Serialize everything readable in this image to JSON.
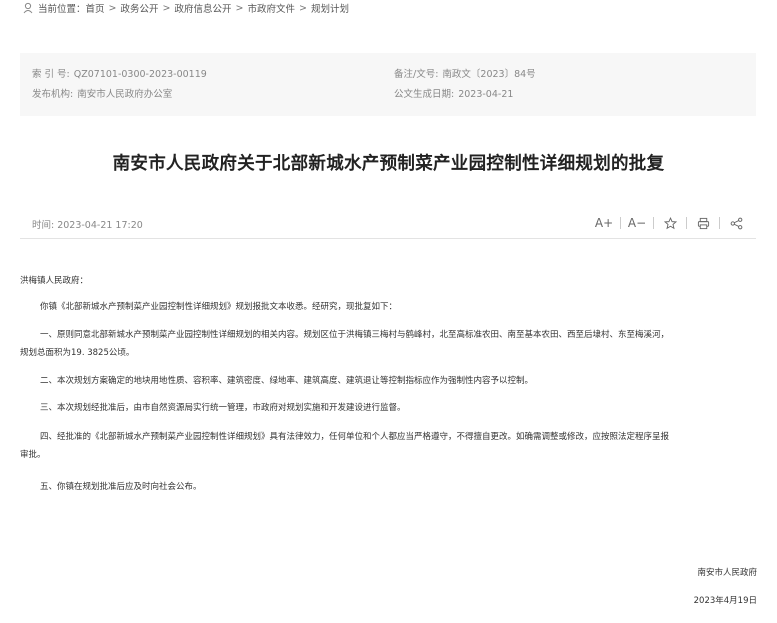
{
  "breadcrumb": {
    "prefix": "当前位置：",
    "items": [
      "首页",
      "政务公开",
      "政府信息公开",
      "市政府文件",
      "规划计划"
    ]
  },
  "meta": {
    "index_label": "索 引 号:",
    "index_value": "QZ07101-0300-2023-00119",
    "docno_label": "备注/文号:",
    "docno_value": "南政文〔2023〕84号",
    "org_label": "发布机构:",
    "org_value": "南安市人民政府办公室",
    "date_label": "公文生成日期:",
    "date_value": "2023-04-21"
  },
  "title": "南安市人民政府关于北部新城水产预制菜产业园控制性详细规划的批复",
  "info": {
    "time_label": "时间:",
    "time_value": "2023-04-21 17:20",
    "font_up": "A+",
    "font_down": "A−"
  },
  "body": {
    "salutation": "洪梅镇人民政府：",
    "para1": "你镇《北部新城水产预制菜产业园控制性详细规划》规划报批文本收悉。经研究，现批复如下：",
    "para2_line1": "一、原则同意北部新城水产预制菜产业园控制性详细规划的相关内容。规划区位于洪梅镇三梅村与鹤峰村，北至高标准农田、南至基本农田、西至后埭村、东至梅溪河，",
    "para2_line2": "规划总面积为19. 3825公顷。",
    "para3": "二、本次规划方案确定的地块用地性质、容积率、建筑密度、绿地率、建筑高度、建筑退让等控制指标应作为强制性内容予以控制。",
    "para4": "三、本次规划经批准后，由市自然资源局实行统一管理，市政府对规划实施和开发建设进行监督。",
    "para5_line1": "四、经批准的《北部新城水产预制菜产业园控制性详细规划》具有法律效力，任何单位和个人都应当严格遵守，不得擅自更改。如确需调整或修改，应按照法定程序呈报",
    "para5_line2": "审批。",
    "para6": "五、你镇在规划批准后应及时向社会公布。",
    "sign_org": "南安市人民政府",
    "sign_date": "2023年4月19日"
  },
  "icons": [
    "location-icon",
    "font-increase-icon",
    "font-decrease-icon",
    "favorite-star-icon",
    "print-icon",
    "share-icon"
  ]
}
